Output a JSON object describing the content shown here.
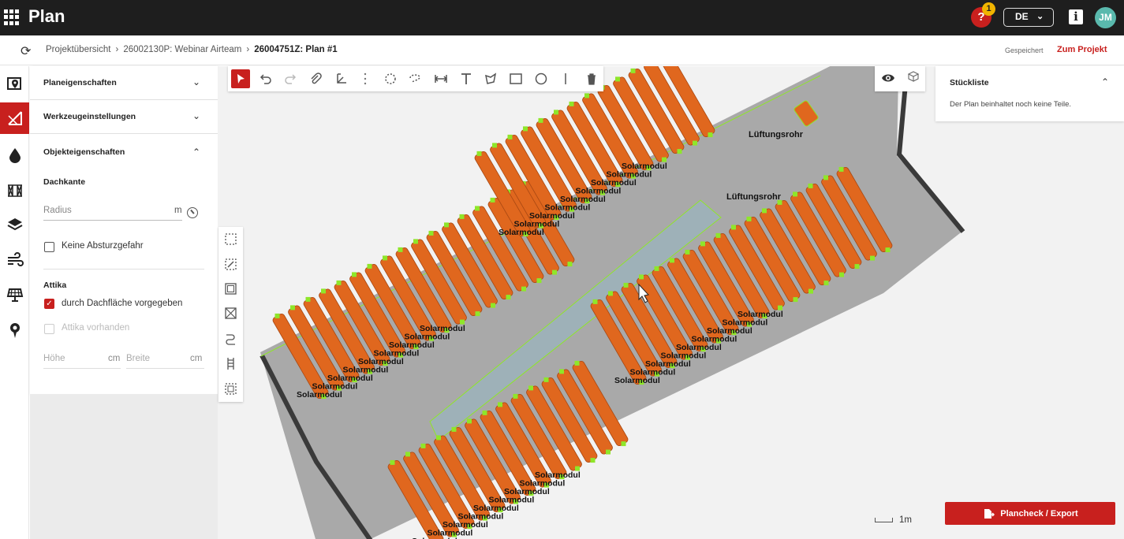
{
  "app": {
    "title": "Plan"
  },
  "topbar": {
    "help_label": "?",
    "help_badge": "1",
    "language": "DE",
    "info_label": "i",
    "user_initials": "JM"
  },
  "breadcrumb": {
    "items": [
      "Projektübersicht",
      "26002130P: Webinar Airteam"
    ],
    "current": "26004751Z: Plan #1",
    "saved_status": "Gespeichert",
    "project_link": "Zum Projekt"
  },
  "sidebar": {
    "rail_icons": [
      "map-pin-icon",
      "roof-edge-icon",
      "drop-icon",
      "fence-icon",
      "layers-icon",
      "wind-icon",
      "solar-panel-icon",
      "location-icon"
    ],
    "sections": [
      {
        "title": "Planeigenschaften",
        "expanded": false
      },
      {
        "title": "Werkzeugeinstellungen",
        "expanded": false
      },
      {
        "title": "Objekteigenschaften",
        "expanded": true
      }
    ],
    "object": {
      "roof_edge_label": "Dachkante",
      "radius_placeholder": "Radius",
      "radius_unit": "m",
      "no_fall_hazard_label": "Keine Absturzgefahr",
      "no_fall_hazard_checked": false,
      "parapet_label": "Attika",
      "defined_by_roof_label": "durch Dachfläche vorgegeben",
      "defined_by_roof_checked": true,
      "parapet_present_label": "Attika vorhanden",
      "parapet_present_checked": false,
      "height_placeholder": "Höhe",
      "height_unit": "cm",
      "width_placeholder": "Breite",
      "width_unit": "cm"
    }
  },
  "parts_list": {
    "title": "Stückliste",
    "empty_message": "Der Plan beinhaltet noch keine Teile."
  },
  "canvas": {
    "module_label": "Solarmodul",
    "vent_label": "Lüftungsrohr",
    "scale_label": "1m",
    "colors": {
      "module": "#e0671e",
      "module_border": "#a84812",
      "roof": "#a9a9a9",
      "skylight": "#9eb1b8",
      "edge_marker": "#8fe62a",
      "roof_edge": "#3a3a3a"
    }
  },
  "export": {
    "label": "Plancheck / Export"
  }
}
